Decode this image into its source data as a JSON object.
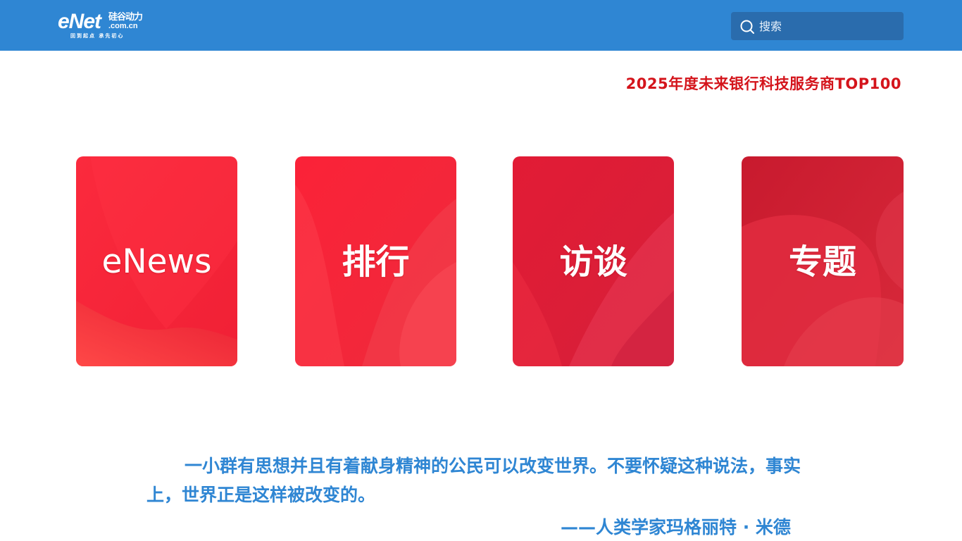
{
  "header": {
    "logo": {
      "brand": "eNet",
      "brand_cn": "硅谷动力",
      "domain": ".com.cn",
      "slogan": "回到起点 承先初心"
    },
    "search": {
      "placeholder": "搜索",
      "value": ""
    },
    "colors": {
      "bar": "#2f86d3",
      "search_bg": "#2a6cad"
    }
  },
  "top_link": {
    "label": "2025年度未来银行科技服务商TOP100",
    "color": "#d4141b"
  },
  "cards": [
    {
      "label": "eNews"
    },
    {
      "label": "排行"
    },
    {
      "label": "访谈"
    },
    {
      "label": "专题"
    }
  ],
  "quote": {
    "text": "一小群有思想并且有着献身精神的公民可以改变世界。不要怀疑这种说法，事实上，世界正是这样被改变的。",
    "author": "——人类学家玛格丽特 · 米德",
    "color": "#2f86d3"
  }
}
